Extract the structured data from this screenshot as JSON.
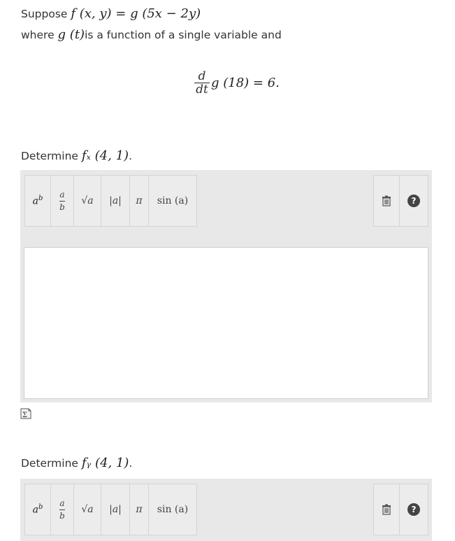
{
  "problem": {
    "line1_prefix": "Suppose",
    "line1_math": "f (x, y) = g (5x − 2y)",
    "line2_prefix": "where",
    "line2_math": "g (t)",
    "line2_suffix": "is a function of a single variable and",
    "display_num": "d",
    "display_den": "dt",
    "display_rest": "g (18) = 6."
  },
  "questions": [
    {
      "prefix": "Determine",
      "math": "fₓ (4, 1)",
      "suffix": "."
    },
    {
      "prefix": "Determine",
      "math": "fᵧ (4, 1)",
      "suffix": "."
    }
  ],
  "toolbar": {
    "power": {
      "base": "a",
      "exp": "b"
    },
    "fraction": {
      "num": "a",
      "den": "b"
    },
    "sqrt": "√a",
    "abs": "|a|",
    "pi": "π",
    "sin": "sin (a)",
    "help": "?"
  },
  "answer": {
    "value": ""
  },
  "icons": [
    "power-icon",
    "fraction-icon",
    "sqrt-icon",
    "abs-icon",
    "pi-icon",
    "sin-icon",
    "trash-icon",
    "help-icon",
    "sigma-icon"
  ]
}
